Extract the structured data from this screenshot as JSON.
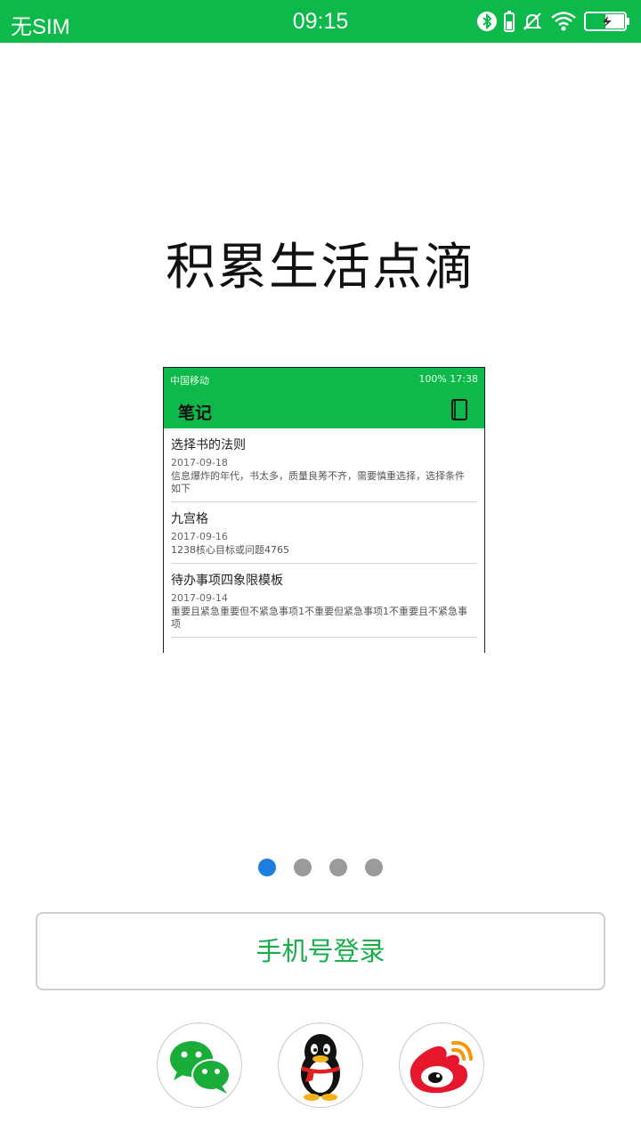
{
  "status_bar": {
    "carrier": "无SIM",
    "time": "09:15",
    "icons": [
      "bluetooth-icon",
      "battery-small-icon",
      "mute-icon",
      "wifi-icon",
      "battery-charging-icon"
    ]
  },
  "headline": "积累生活点滴",
  "preview": {
    "status_left": "中国移动",
    "status_right": "100% 17:38",
    "app_title": "笔记",
    "notes": [
      {
        "title": "选择书的法则",
        "date": "2017-09-18",
        "body": "信息爆炸的年代，书太多，质量良莠不齐，需要慎重选择，选择条件如下"
      },
      {
        "title": "九宫格",
        "date": "2017-09-16",
        "body": "1238核心目标或问题4765"
      },
      {
        "title": "待办事项四象限模板",
        "date": "2017-09-14",
        "body": "重要且紧急重要但不紧急事项1不重要但紧急事项1不重要且不紧急事项"
      }
    ]
  },
  "pager": {
    "count": 4,
    "active": 0
  },
  "login_button": "手机号登录",
  "social_logins": [
    "wechat-icon",
    "qq-icon",
    "weibo-icon"
  ],
  "colors": {
    "brand_green": "#0db94b",
    "login_text": "#17ad4a",
    "dot_active": "#1c7fe0",
    "dot_inactive": "#9a9c9c"
  }
}
